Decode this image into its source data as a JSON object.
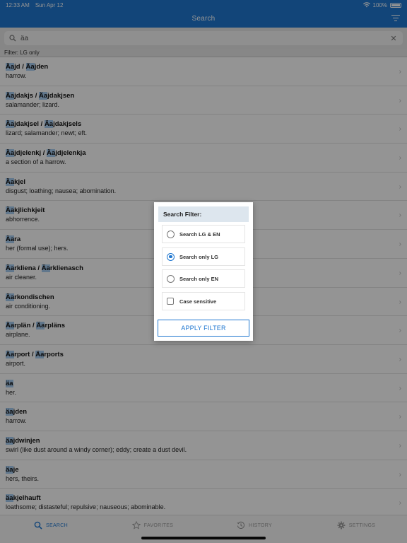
{
  "status_bar": {
    "time": "12:33 AM",
    "date": "Sun Apr 12",
    "battery": "100%"
  },
  "nav": {
    "title": "Search"
  },
  "search": {
    "value": "äa",
    "placeholder": ""
  },
  "filter_label": "Filter: LG only",
  "results": [
    {
      "parts": [
        [
          "Äa",
          true
        ],
        [
          "jd / ",
          false
        ],
        [
          "Äa",
          true
        ],
        [
          "jden",
          false
        ]
      ],
      "definition": "harrow."
    },
    {
      "parts": [
        [
          "Äa",
          true
        ],
        [
          "jdakjs / ",
          false
        ],
        [
          "Äa",
          true
        ],
        [
          "jdakjsen",
          false
        ]
      ],
      "definition": "salamander; lizard."
    },
    {
      "parts": [
        [
          "Äa",
          true
        ],
        [
          "jdakjsel / ",
          false
        ],
        [
          "Äa",
          true
        ],
        [
          "jdakjsels",
          false
        ]
      ],
      "definition": "lizard; salamander; newt; eft."
    },
    {
      "parts": [
        [
          "Äa",
          true
        ],
        [
          "jdjelenkj / ",
          false
        ],
        [
          "Äa",
          true
        ],
        [
          "jdjelenkja",
          false
        ]
      ],
      "definition": "a section of a harrow."
    },
    {
      "parts": [
        [
          "Äa",
          true
        ],
        [
          "kjel",
          false
        ]
      ],
      "definition": "disgust; loathing; nausea; abomination."
    },
    {
      "parts": [
        [
          "Äa",
          true
        ],
        [
          "kjlichkjeit",
          false
        ]
      ],
      "definition": "abhorrence."
    },
    {
      "parts": [
        [
          "Äa",
          true
        ],
        [
          "ra",
          false
        ]
      ],
      "definition": "her (formal use); hers."
    },
    {
      "parts": [
        [
          "Äa",
          true
        ],
        [
          "rkliena / ",
          false
        ],
        [
          "Äa",
          true
        ],
        [
          "rklienasch",
          false
        ]
      ],
      "definition": "air cleaner."
    },
    {
      "parts": [
        [
          "Äa",
          true
        ],
        [
          "rkondischen",
          false
        ]
      ],
      "definition": "air conditioning."
    },
    {
      "parts": [
        [
          "Äa",
          true
        ],
        [
          "rplän / ",
          false
        ],
        [
          "Äa",
          true
        ],
        [
          "rpläns",
          false
        ]
      ],
      "definition": "airplane."
    },
    {
      "parts": [
        [
          "Äa",
          true
        ],
        [
          "rport / ",
          false
        ],
        [
          "Äa",
          true
        ],
        [
          "rports",
          false
        ]
      ],
      "definition": "airport."
    },
    {
      "parts": [
        [
          "äa",
          true
        ]
      ],
      "definition": "her."
    },
    {
      "parts": [
        [
          "äa",
          true
        ],
        [
          "jden",
          false
        ]
      ],
      "definition": "harrow."
    },
    {
      "parts": [
        [
          "äa",
          true
        ],
        [
          "jdwinjen",
          false
        ]
      ],
      "definition": "swirl (like dust around a windy corner); eddy; create a dust devil."
    },
    {
      "parts": [
        [
          "äa",
          true
        ],
        [
          "je",
          false
        ]
      ],
      "definition": "hers, theirs."
    },
    {
      "parts": [
        [
          "äa",
          true
        ],
        [
          "kjelhauft",
          false
        ]
      ],
      "definition": "loathsome; distasteful; repulsive; nauseous; abominable."
    }
  ],
  "tabs": [
    {
      "label": "SEARCH",
      "icon": "search-icon"
    },
    {
      "label": "FAVORITES",
      "icon": "star-icon"
    },
    {
      "label": "HISTORY",
      "icon": "history-icon"
    },
    {
      "label": "SETTINGS",
      "icon": "gear-icon"
    }
  ],
  "dialog": {
    "title": "Search Filter:",
    "options": [
      "Search LG & EN",
      "Search only LG",
      "Search only EN"
    ],
    "selected_option": "Search only LG",
    "checkbox_label": "Case sensitive",
    "checkbox_checked": false,
    "apply_label": "APPLY FILTER"
  },
  "colors": {
    "accent": "#1f77d0",
    "highlight": "#a8cdf2"
  }
}
